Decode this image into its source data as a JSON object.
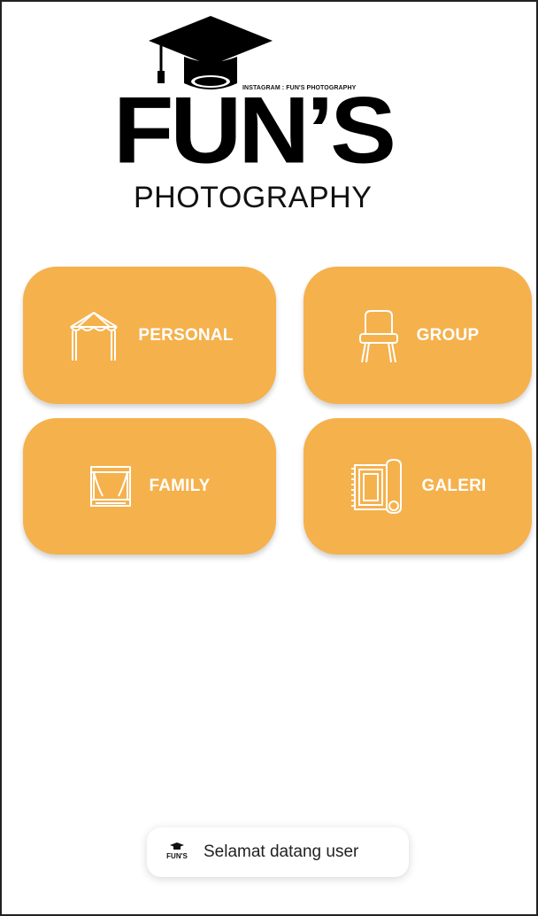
{
  "logo": {
    "instagram_line": "INSTAGRAM : FUN'S PHOTOGRAPHY",
    "brand": "FUN’S",
    "subtitle": "PHOTOGRAPHY"
  },
  "menu": {
    "personal": {
      "label": "PERSONAL",
      "icon": "tent-canopy-icon"
    },
    "group": {
      "label": "GROUP",
      "icon": "chair-icon"
    },
    "family": {
      "label": "FAMILY",
      "icon": "stage-curtain-icon"
    },
    "galeri": {
      "label": "GALERI",
      "icon": "rolled-carpet-icon"
    }
  },
  "toast": {
    "message": "Selamat datang user",
    "icon": "app-logo-icon",
    "icon_text": "FUN'S"
  },
  "colors": {
    "tile_background": "#F5B14C",
    "tile_text": "#FFFFFF",
    "background": "#FFFFFF"
  }
}
